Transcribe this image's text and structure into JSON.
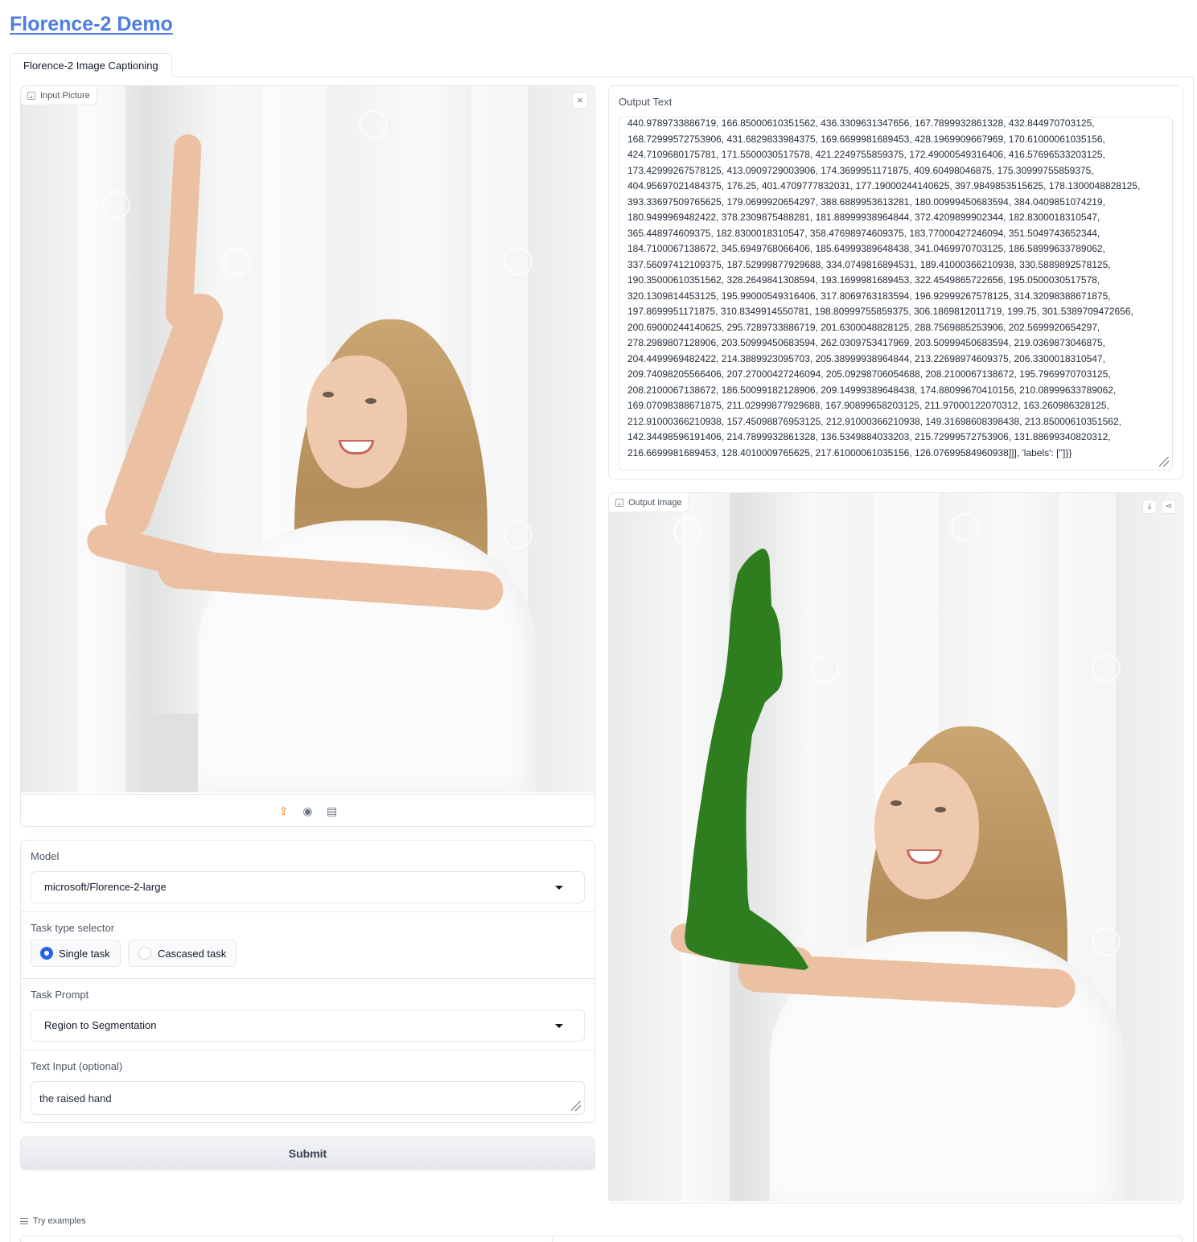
{
  "app": {
    "title": "Florence-2 Demo"
  },
  "tabs": [
    {
      "label": "Florence-2 Image Captioning"
    }
  ],
  "input_image": {
    "label": "Input Picture",
    "close": "×"
  },
  "output_text": {
    "label": "Output Text",
    "value": "440.9789733886719, 166.85000610351562, 436.3309631347656, 167.7899932861328, 432.844970703125, 168.72999572753906, 431.6829833984375, 169.6699981689453, 428.1969909667969, 170.61000061035156, 424.7109680175781, 171.5500030517578, 421.2249755859375, 172.49000549316406, 416.57696533203125, 173.42999267578125, 413.0909729003906, 174.3699951171875, 409.60498046875, 175.30999755859375, 404.95697021484375, 176.25, 401.4709777832031, 177.19000244140625, 397.9849853515625, 178.1300048828125, 393.33697509765625, 179.0699920654297, 388.6889953613281, 180.00999450683594, 384.0409851074219, 180.9499969482422, 378.2309875488281, 181.88999938964844, 372.4209899902344, 182.8300018310547, 365.448974609375, 182.8300018310547, 358.47698974609375, 183.77000427246094, 351.5049743652344, 184.7100067138672, 345.6949768066406, 185.64999389648438, 341.0469970703125, 186.58999633789062, 337.56097412109375, 187.52999877929688, 334.0749816894531, 189.41000366210938, 330.5889892578125, 190.35000610351562, 328.2649841308594, 193.1699981689453, 322.4549865722656, 195.0500030517578, 320.1309814453125, 195.99000549316406, 317.8069763183594, 196.92999267578125, 314.32098388671875, 197.8699951171875, 310.8349914550781, 198.80999755859375, 306.1869812011719, 199.75, 301.5389709472656, 200.69000244140625, 295.7289733886719, 201.6300048828125, 288.7569885253906, 202.5699920654297, 278.2989807128906, 203.50999450683594, 262.0309753417969, 203.50999450683594, 219.0369873046875, 204.4499969482422, 214.3889923095703, 205.38999938964844, 213.22698974609375, 206.3300018310547, 209.74098205566406, 207.27000427246094, 205.09298706054688, 208.2100067138672, 195.7969970703125, 208.2100067138672, 186.50099182128906, 209.14999389648438, 174.88099670410156, 210.08999633789062, 169.07098388671875, 211.02999877929688, 167.90899658203125, 211.97000122070312, 163.260986328125, 212.91000366210938, 157.45098876953125, 212.91000366210938, 149.31698608398438, 213.85000610351562, 142.34498596191406, 214.7899932861328, 136.5349884033203, 215.72999572753906, 131.88699340820312, 216.6699981689453, 128.4010009765625, 217.61000061035156, 126.07699584960938]]], 'labels': ['']}}"
  },
  "output_image": {
    "label": "Output Image",
    "download": "⤓",
    "share": "⋖"
  },
  "image_sources": [
    {
      "icon": "upload-icon",
      "glyph": "⇪"
    },
    {
      "icon": "webcam-icon",
      "glyph": "◉"
    },
    {
      "icon": "clipboard-icon",
      "glyph": "▤"
    }
  ],
  "form": {
    "model_label": "Model",
    "model_value": "microsoft/Florence-2-large",
    "task_type_label": "Task type selector",
    "task_types": [
      {
        "label": "Single task",
        "selected": true
      },
      {
        "label": "Cascased task",
        "selected": false
      }
    ],
    "task_prompt_label": "Task Prompt",
    "task_prompt_value": "Region to Segmentation",
    "text_input_label": "Text Input (optional)",
    "text_input_value": "the raised hand",
    "submit_label": "Submit"
  },
  "examples": {
    "label": "Try examples"
  },
  "colors": {
    "accent": "#4f7de5",
    "radio": "#2563eb",
    "upload": "#f97316",
    "mask": "#2e7d1f"
  }
}
